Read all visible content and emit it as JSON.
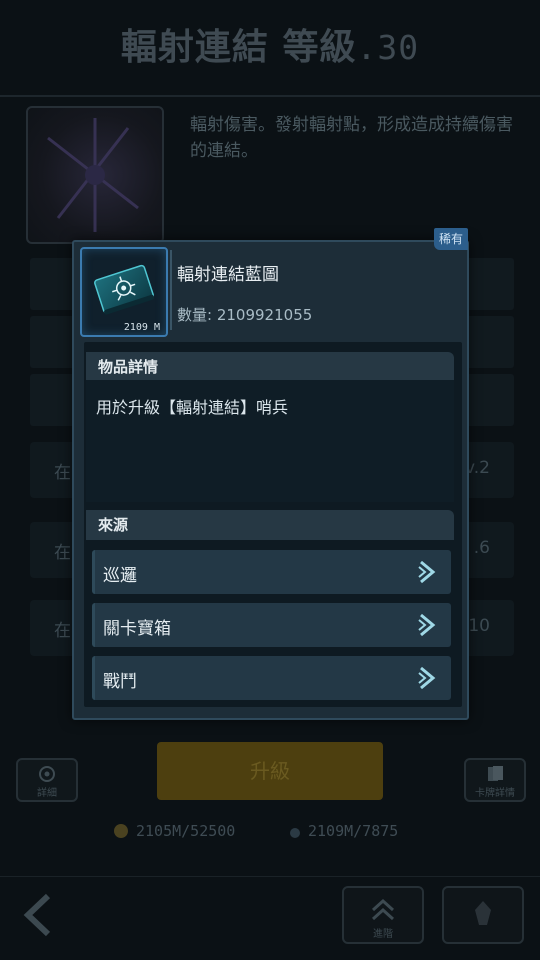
{
  "background": {
    "title": "輻射連結",
    "level_text": "等級",
    "level_value": ".30",
    "description": "輻射傷害。發射輻射點，形成造成持續傷害的連結。",
    "rows": [
      {
        "left": "在",
        "right": "v.2"
      },
      {
        "left": "在",
        "right": ".6"
      },
      {
        "left": "在",
        "right": ".10"
      }
    ],
    "left_button_label": "詳細",
    "right_button_label": "卡牌詳情",
    "upgrade_label": "升級",
    "cost_gold": "2105M/52500",
    "cost_blueprint": "2109M/7875",
    "nav_label": "進階"
  },
  "popup": {
    "rarity": "稀有",
    "item_name": "輻射連結藍圖",
    "item_count_badge": "2109 M",
    "quantity_label": "數量:",
    "quantity_value": "2109921055",
    "details_header": "物品詳情",
    "details_text": "用於升級【輻射連結】哨兵",
    "source_header": "來源",
    "sources": [
      {
        "label": "巡邏",
        "icon": "chevron-right-icon"
      },
      {
        "label": "關卡寶箱",
        "icon": "chevron-right-icon"
      },
      {
        "label": "戰鬥",
        "icon": "chevron-right-icon"
      }
    ]
  },
  "colors": {
    "accent_blue": "#3b7bb0",
    "rarity_badge": "#2c5e8c",
    "popup_bg": "#1d2d38",
    "upgrade_button_dim": "#4d3f0f"
  }
}
